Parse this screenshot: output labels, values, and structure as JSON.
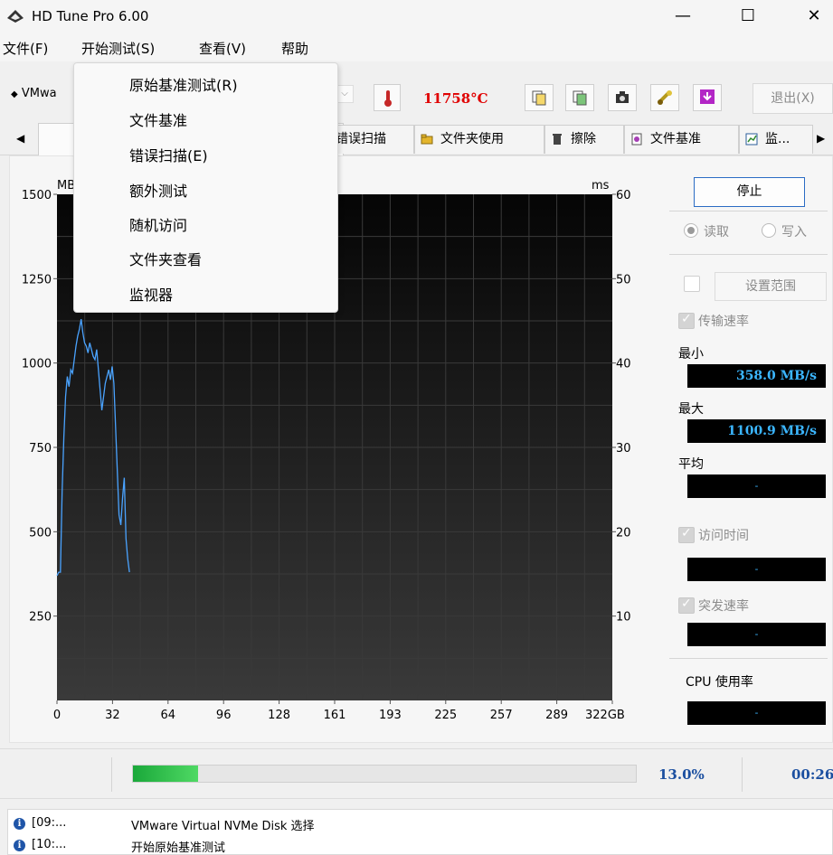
{
  "window": {
    "title": "HD Tune Pro 6.00",
    "minimize": "—",
    "maximize": "☐",
    "close": "✕"
  },
  "menu": [
    "文件(F)",
    "开始测试(S)",
    "查看(V)",
    "帮助"
  ],
  "dropdown": [
    "原始基准测试(R)",
    "文件基准",
    "错误扫描(E)",
    "额外测试",
    "随机访问",
    "文件夹查看",
    "监视器"
  ],
  "toolbar": {
    "drive": "VMwa",
    "temperature": "11758°C",
    "exit": "退出(X)"
  },
  "tabs": [
    "错误扫描",
    "文件夹使用",
    "擦除",
    "文件基准",
    "监..."
  ],
  "chart_data": {
    "type": "line",
    "y_left_label": "MB",
    "y_right_label": "ms",
    "y_left_ticks": [
      "1500",
      "1250",
      "1000",
      "750",
      "500",
      "250"
    ],
    "y_right_ticks": [
      "60",
      "50",
      "40",
      "30",
      "20",
      "10"
    ],
    "x_ticks": [
      "0",
      "32",
      "64",
      "96",
      "128",
      "161",
      "193",
      "225",
      "257",
      "289",
      "322GB"
    ],
    "ylim": [
      0,
      1500
    ],
    "xlim": [
      0,
      322
    ],
    "grid": true,
    "series": [
      {
        "color": "#4aa3ff",
        "points": [
          [
            0,
            370
          ],
          [
            1,
            380
          ],
          [
            2,
            380
          ],
          [
            3,
            620
          ],
          [
            4,
            780
          ],
          [
            5,
            900
          ],
          [
            6,
            960
          ],
          [
            7,
            930
          ],
          [
            8,
            980
          ],
          [
            9,
            970
          ],
          [
            10,
            1010
          ],
          [
            11,
            1050
          ],
          [
            12,
            1080
          ],
          [
            13,
            1100
          ],
          [
            14,
            1130
          ],
          [
            15,
            1090
          ],
          [
            16,
            1060
          ],
          [
            17,
            1050
          ],
          [
            18,
            1030
          ],
          [
            19,
            1060
          ],
          [
            20,
            1040
          ],
          [
            21,
            1020
          ],
          [
            22,
            1010
          ],
          [
            23,
            1040
          ],
          [
            24,
            980
          ],
          [
            25,
            920
          ],
          [
            26,
            860
          ],
          [
            27,
            900
          ],
          [
            28,
            940
          ],
          [
            29,
            960
          ],
          [
            30,
            980
          ],
          [
            31,
            950
          ],
          [
            32,
            990
          ],
          [
            33,
            940
          ],
          [
            34,
            810
          ],
          [
            35,
            680
          ],
          [
            36,
            550
          ],
          [
            37,
            520
          ],
          [
            38,
            600
          ],
          [
            39,
            660
          ],
          [
            40,
            480
          ],
          [
            41,
            420
          ],
          [
            42,
            380
          ]
        ]
      }
    ]
  },
  "side": {
    "stop": "停止",
    "read": "读取",
    "write": "写入",
    "set_range": "设置范围",
    "transfer_rate": "传输速率",
    "min_label": "最小",
    "min_value": "358.0 MB/s",
    "max_label": "最大",
    "max_value": "1100.9 MB/s",
    "avg_label": "平均",
    "avg_value": "-",
    "access_time": "访问时间",
    "access_value": "-",
    "burst_rate": "突发速率",
    "burst_value": "-",
    "cpu_label": "CPU 使用率",
    "cpu_value": "-"
  },
  "progress": {
    "fraction": 0.13,
    "percent": "13.0%",
    "elapsed": "00:26"
  },
  "log": [
    {
      "time": "[09:...",
      "msg": "VMware Virtual NVMe Disk 选择"
    },
    {
      "time": "[10:...",
      "msg": "开始原始基准测试"
    }
  ]
}
